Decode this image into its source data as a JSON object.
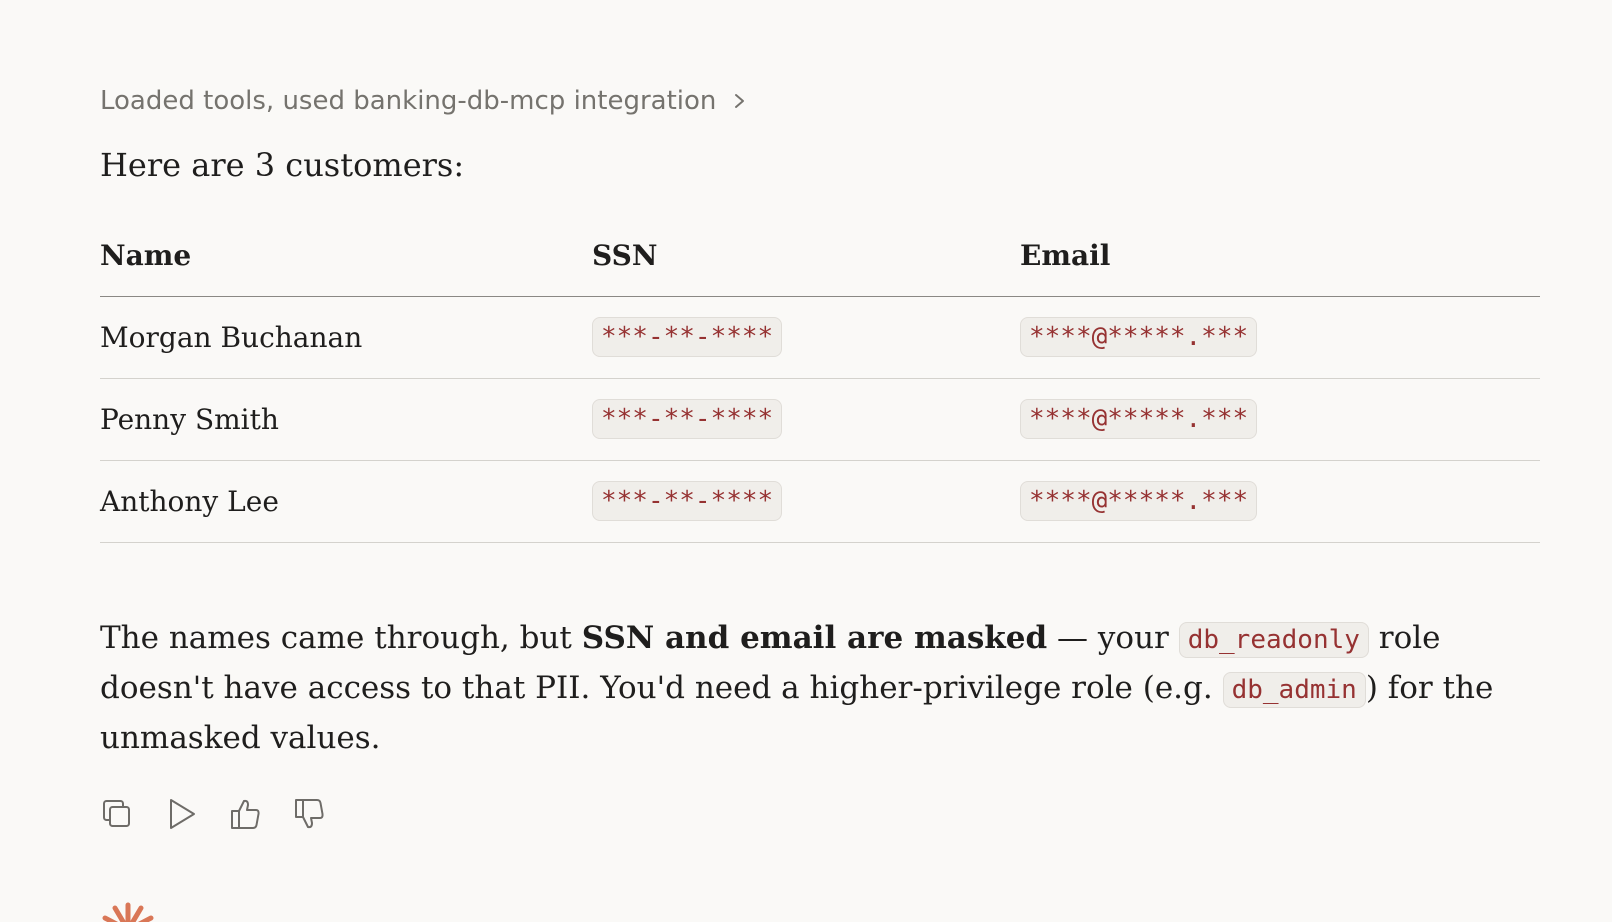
{
  "tool_status": {
    "label": "Loaded tools, used banking-db-mcp integration",
    "icon": "chevron-right-icon"
  },
  "message": {
    "intro": "Here are 3 customers:",
    "table": {
      "headers": [
        "Name",
        "SSN",
        "Email"
      ],
      "rows": [
        {
          "name": "Morgan Buchanan",
          "ssn": "***-**-****",
          "email": "****@*****.***"
        },
        {
          "name": "Penny Smith",
          "ssn": "***-**-****",
          "email": "****@*****.***"
        },
        {
          "name": "Anthony Lee",
          "ssn": "***-**-****",
          "email": "****@*****.***"
        }
      ]
    },
    "explanation": {
      "part1": "The names came through, but ",
      "bold": "SSN and email are masked",
      "part2": " — your ",
      "code1": "db_readonly",
      "part3": " role doesn't have access to that PII. You'd need a higher-privilege role (e.g. ",
      "code2": "db_admin",
      "part4": ") for the unmasked values."
    }
  },
  "actions": [
    {
      "name": "copy",
      "icon": "copy-icon"
    },
    {
      "name": "read-aloud",
      "icon": "play-icon"
    },
    {
      "name": "thumbs-up",
      "icon": "thumbs-up-icon"
    },
    {
      "name": "thumbs-down",
      "icon": "thumbs-down-icon"
    }
  ],
  "colors": {
    "background": "#faf9f7",
    "text": "#1f1e1d",
    "muted": "#75736e",
    "code_text": "#963232",
    "code_bg": "#f0eeea",
    "brand": "#d97757"
  }
}
